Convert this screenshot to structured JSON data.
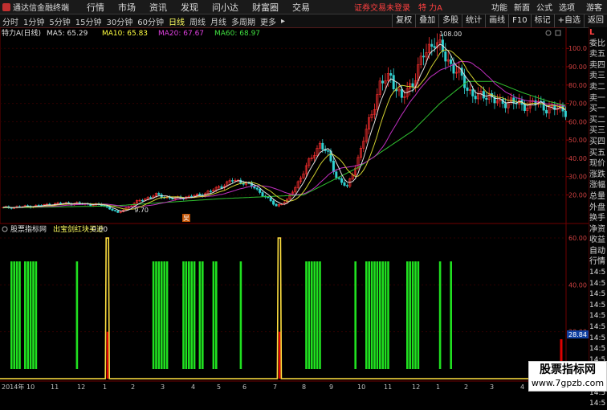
{
  "top": {
    "app_title": "通达信金融终端",
    "menus": [
      "行情",
      "市场",
      "资讯",
      "发现",
      "问小达",
      "财富圈",
      "交易"
    ],
    "login_status": "证券交易未登录",
    "stock": "特 力A",
    "right": [
      "功能",
      "新面",
      "公式",
      "选项"
    ],
    "guest": "游客"
  },
  "toolbar": {
    "periods": [
      "分时",
      "1分钟",
      "5分钟",
      "15分钟",
      "30分钟",
      "60分钟",
      "日线",
      "周线",
      "月线",
      "多周期",
      "更多"
    ],
    "active_period": "日线",
    "more_arrow": "▸",
    "tools": [
      "复权",
      "叠加",
      "多股",
      "统计",
      "画线",
      "F10",
      "标记",
      "+自选",
      "返回"
    ]
  },
  "main_chart": {
    "stock_label": "特力A",
    "period_label": "(日线)",
    "ma": [
      {
        "label": "MA5: 65.29",
        "color": "#e0e0e0"
      },
      {
        "label": "MA10: 65.83",
        "color": "#ffff40"
      },
      {
        "label": "MA20: 67.67",
        "color": "#e040e0"
      },
      {
        "label": "MA60: 68.97",
        "color": "#40e040"
      }
    ],
    "price_ticks": [
      "100.0",
      "90.00",
      "80.00",
      "70.00",
      "60.00",
      "50.00",
      "40.00",
      "30.00",
      "20.00"
    ],
    "price_ticks_values": [
      100,
      90,
      80,
      70,
      60,
      50,
      40,
      30,
      20
    ],
    "high_label": "108.00",
    "low_label": "9.70",
    "marker": "吴"
  },
  "indicator": {
    "title": "股票指标网",
    "name": "出宝剑红块买进",
    "value": "0.00",
    "ticks": [
      "60.00",
      "40.00",
      "20.00"
    ],
    "ticks_values": [
      60,
      40,
      20
    ],
    "current_value": "28.84"
  },
  "x_axis": {
    "labels": [
      "2014年",
      "10",
      "11",
      "12",
      "1",
      "2",
      "3",
      "4",
      "5",
      "6",
      "7",
      "8",
      "9",
      "10",
      "11",
      "12",
      "1",
      "2",
      "3",
      "4"
    ]
  },
  "side_panel": {
    "items": [
      "委比",
      "卖五",
      "卖四",
      "卖三",
      "卖二",
      "卖一",
      "买一",
      "买二",
      "买三",
      "买四",
      "买五",
      "现价",
      "涨跌",
      "涨幅",
      "总量",
      "外盘",
      "换手",
      "净资",
      "收益"
    ],
    "auto_label": "自动",
    "detail_label": "行情",
    "times": [
      "14:5",
      "14:5",
      "14:5",
      "14:5",
      "14:5",
      "14:5",
      "14:5",
      "14:5",
      "14:5",
      "14:5",
      "14:5",
      "14:5",
      "14:5"
    ],
    "corner": "L"
  },
  "watermark": {
    "line1": "股票指标网",
    "line2": "www.7gpzb.com"
  },
  "chart_data": {
    "type": "line",
    "title": "特力A (日线)",
    "price_axis": {
      "ylim": [
        9.7,
        108.0
      ],
      "ticks": [
        20,
        30,
        40,
        50,
        60,
        70,
        80,
        90,
        100
      ]
    },
    "x_labels": [
      "2014年",
      "10",
      "11",
      "12",
      "1",
      "2",
      "3",
      "4",
      "5",
      "6",
      "7",
      "8",
      "9",
      "10",
      "11",
      "12",
      "1",
      "2",
      "3",
      "4"
    ],
    "series": [
      {
        "name": "MA5",
        "last": 65.29,
        "color": "#e0e0e0"
      },
      {
        "name": "MA10",
        "last": 65.83,
        "color": "#ffff40"
      },
      {
        "name": "MA20",
        "last": 67.67,
        "color": "#e040e0"
      },
      {
        "name": "MA60",
        "last": 68.97,
        "color": "#40e040"
      }
    ],
    "price_path": [
      [
        0,
        13
      ],
      [
        6,
        13.5
      ],
      [
        12,
        14
      ],
      [
        18,
        15
      ],
      [
        24,
        15.5
      ],
      [
        30,
        15
      ],
      [
        36,
        14.5
      ],
      [
        40,
        12
      ],
      [
        42,
        10
      ],
      [
        44,
        12
      ],
      [
        50,
        17
      ],
      [
        56,
        20
      ],
      [
        62,
        18
      ],
      [
        68,
        19
      ],
      [
        72,
        20
      ],
      [
        76,
        22
      ],
      [
        80,
        25
      ],
      [
        84,
        28
      ],
      [
        88,
        27
      ],
      [
        92,
        24
      ],
      [
        96,
        19
      ],
      [
        100,
        14
      ],
      [
        104,
        17
      ],
      [
        108,
        27
      ],
      [
        112,
        38
      ],
      [
        116,
        48
      ],
      [
        119,
        42
      ],
      [
        122,
        30
      ],
      [
        126,
        24
      ],
      [
        130,
        40
      ],
      [
        134,
        60
      ],
      [
        138,
        80
      ],
      [
        142,
        85
      ],
      [
        146,
        72
      ],
      [
        150,
        82
      ],
      [
        154,
        96
      ],
      [
        158,
        105
      ],
      [
        162,
        95
      ],
      [
        166,
        88
      ],
      [
        170,
        78
      ],
      [
        174,
        73
      ],
      [
        178,
        75
      ],
      [
        182,
        69
      ],
      [
        186,
        72
      ],
      [
        190,
        68
      ],
      [
        194,
        71
      ],
      [
        198,
        68
      ],
      [
        202,
        67
      ],
      [
        206,
        66
      ]
    ],
    "ma60_path": [
      [
        0,
        13
      ],
      [
        40,
        14
      ],
      [
        80,
        18
      ],
      [
        110,
        20
      ],
      [
        130,
        35
      ],
      [
        150,
        55
      ],
      [
        160,
        70
      ],
      [
        170,
        82
      ],
      [
        180,
        82
      ],
      [
        190,
        76
      ],
      [
        200,
        71
      ],
      [
        206,
        69
      ]
    ],
    "indicator": {
      "ylim": [
        0,
        60
      ],
      "ticks": [
        20,
        40,
        60
      ],
      "yellow_spikes": [
        38,
        101
      ],
      "green_bars": [
        [
          3,
          6
        ],
        [
          8,
          12
        ],
        [
          27,
          27
        ],
        [
          55,
          60
        ],
        [
          66,
          70
        ],
        [
          72,
          73
        ],
        [
          77,
          78
        ],
        [
          87,
          87
        ],
        [
          111,
          116
        ],
        [
          129,
          129
        ],
        [
          133,
          141
        ],
        [
          148,
          152
        ],
        [
          160,
          160
        ],
        [
          164,
          164
        ]
      ],
      "last_value": 28.84
    }
  }
}
